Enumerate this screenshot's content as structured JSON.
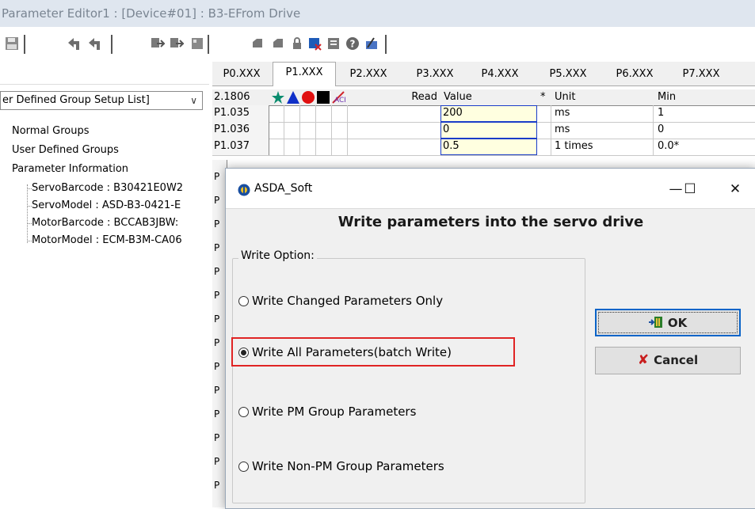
{
  "window": {
    "title": "Parameter Editor1 : [Device#01] : B3-EFrom Drive"
  },
  "toolbar": {
    "icons": [
      "save-icon",
      "read-icon",
      "read-all-icon",
      "write-icon",
      "write-all-icon",
      "grid-icon",
      "print-icon",
      "print-preview-icon",
      "lock-icon",
      "compare-icon",
      "export-icon",
      "help-icon",
      "tools-icon"
    ]
  },
  "left_panel": {
    "combo_value": "er Defined Group Setup List]",
    "tree": {
      "normal_groups": "Normal Groups",
      "user_defined_groups": "User Defined Groups",
      "parameter_information": "Parameter Information",
      "children": [
        "ServoBarcode : B30421E0W2",
        "ServoModel : ASD-B3-0421-E",
        "MotorBarcode : BCCAB3JBW:",
        "MotorModel : ECM-B3M-CA06"
      ]
    }
  },
  "tabs": [
    {
      "label": "P0.XXX",
      "active": false
    },
    {
      "label": "P1.XXX",
      "active": true
    },
    {
      "label": "P2.XXX",
      "active": false
    },
    {
      "label": "P3.XXX",
      "active": false
    },
    {
      "label": "P4.XXX",
      "active": false
    },
    {
      "label": "P5.XXX",
      "active": false
    },
    {
      "label": "P6.XXX",
      "active": false
    },
    {
      "label": "P7.XXX",
      "active": false
    }
  ],
  "grid": {
    "header": {
      "version": "2.1806",
      "read": "Read",
      "value": "Value",
      "star": "*",
      "unit": "Unit",
      "min": "Min"
    },
    "rows": [
      {
        "param": "P1.035",
        "value": "200",
        "unit": "ms",
        "min": "1"
      },
      {
        "param": "P1.036",
        "value": "0",
        "unit": "ms",
        "min": "0"
      },
      {
        "param": "P1.037",
        "value": "0.5",
        "unit": "1 times",
        "min": "0.0*"
      }
    ],
    "stub_label": "P"
  },
  "dialog": {
    "app_title": "ASDA_Soft",
    "minimize": "—",
    "maximize": "☐",
    "close": "✕",
    "headline": "Write parameters into the servo drive",
    "group_label": "Write Option:",
    "options": [
      {
        "label": "Write Changed Parameters Only",
        "selected": false
      },
      {
        "label": "Write All Parameters(batch Write)",
        "selected": true
      },
      {
        "label": "Write PM Group Parameters",
        "selected": false
      },
      {
        "label": "Write Non-PM Group Parameters",
        "selected": false
      }
    ],
    "ok_label": "OK",
    "cancel_label": "Cancel",
    "cancel_icon": "✘",
    "highlight_color": "#e02424"
  }
}
